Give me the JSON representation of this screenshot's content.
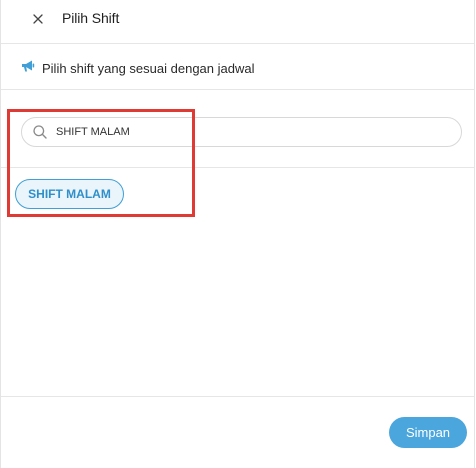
{
  "header": {
    "title": "Pilih Shift",
    "close_icon": "close-icon"
  },
  "info": {
    "icon": "megaphone-icon",
    "text": "Pilih shift yang sesuai dengan jadwal"
  },
  "search": {
    "icon": "search-icon",
    "value": "SHIFT MALAM",
    "placeholder": ""
  },
  "results": [
    {
      "label": "SHIFT MALAM",
      "selected": true
    }
  ],
  "footer": {
    "save_label": "Simpan"
  },
  "colors": {
    "accent": "#4aa6dc",
    "chip_border": "#3f9fd6",
    "chip_bg": "#e9f4fb",
    "highlight": "#e03a34"
  }
}
